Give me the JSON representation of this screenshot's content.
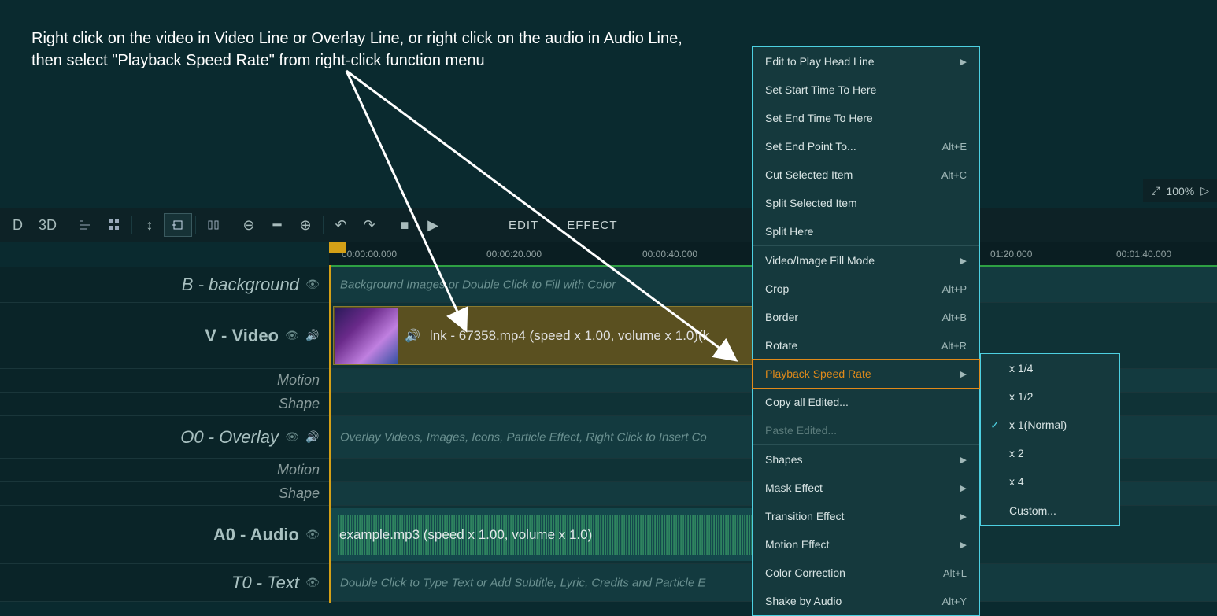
{
  "instruction_line1": "Right click on the video in Video Line or Overlay Line, or right click on the audio in Audio Line,",
  "instruction_line2": "then select \"Playback Speed Rate\" from right-click function menu",
  "zoom": {
    "value": "100%"
  },
  "toolbar": {
    "d": "D",
    "three_d": "3D",
    "edit": "EDIT",
    "effect": "EFFECT"
  },
  "ruler": {
    "ticks": [
      "00:00:00.000",
      "00:00:20.000",
      "00:00:40.000",
      "01:20.000",
      "00:01:40.000"
    ],
    "positions": [
      0,
      200,
      400,
      840,
      1000
    ]
  },
  "tracks": {
    "bg": {
      "label": "B - background",
      "placeholder": "Background Images or Double Click to Fill with Color"
    },
    "video": {
      "label": "V - Video",
      "clip": "lnk - 67358.mp4  (speed x 1.00, volume x 1.0)(k"
    },
    "motion_label": "Motion",
    "shape_label": "Shape",
    "overlay": {
      "label": "O0 - Overlay",
      "placeholder": "Overlay Videos, Images, Icons, Particle Effect, Right Click to Insert Co"
    },
    "audio": {
      "label": "A0 - Audio",
      "clip": "example.mp3  (speed x 1.00, volume x 1.0)"
    },
    "text": {
      "label": "T0 - Text",
      "placeholder": "Double Click to Type Text or Add Subtitle, Lyric, Credits and Particle E"
    }
  },
  "context_menu": [
    {
      "label": "Edit to Play Head Line",
      "type": "submenu"
    },
    {
      "label": "Set Start Time To Here"
    },
    {
      "label": "Set End Time To Here"
    },
    {
      "label": "Set End Point To...",
      "shortcut": "Alt+E"
    },
    {
      "label": "Cut Selected Item",
      "shortcut": "Alt+C"
    },
    {
      "label": "Split Selected Item"
    },
    {
      "label": "Split Here"
    },
    {
      "sep": true
    },
    {
      "label": "Video/Image Fill Mode",
      "type": "submenu"
    },
    {
      "label": "Crop",
      "shortcut": "Alt+P"
    },
    {
      "label": "Border",
      "shortcut": "Alt+B"
    },
    {
      "label": "Rotate",
      "shortcut": "Alt+R"
    },
    {
      "label": "Playback Speed Rate",
      "type": "submenu",
      "highlighted": true
    },
    {
      "label": "Copy all Edited..."
    },
    {
      "label": "Paste Edited...",
      "disabled": true
    },
    {
      "sep": true
    },
    {
      "label": "Shapes",
      "type": "submenu"
    },
    {
      "label": "Mask Effect",
      "type": "submenu"
    },
    {
      "label": "Transition Effect",
      "type": "submenu"
    },
    {
      "label": "Motion Effect",
      "type": "submenu"
    },
    {
      "label": "Color Correction",
      "shortcut": "Alt+L"
    },
    {
      "label": "Shake by Audio",
      "shortcut": "Alt+Y"
    }
  ],
  "submenu": [
    {
      "label": "x 1/4"
    },
    {
      "label": "x 1/2"
    },
    {
      "label": "x 1(Normal)",
      "checked": true
    },
    {
      "label": "x 2"
    },
    {
      "label": "x 4"
    },
    {
      "sep": true
    },
    {
      "label": "Custom..."
    }
  ]
}
